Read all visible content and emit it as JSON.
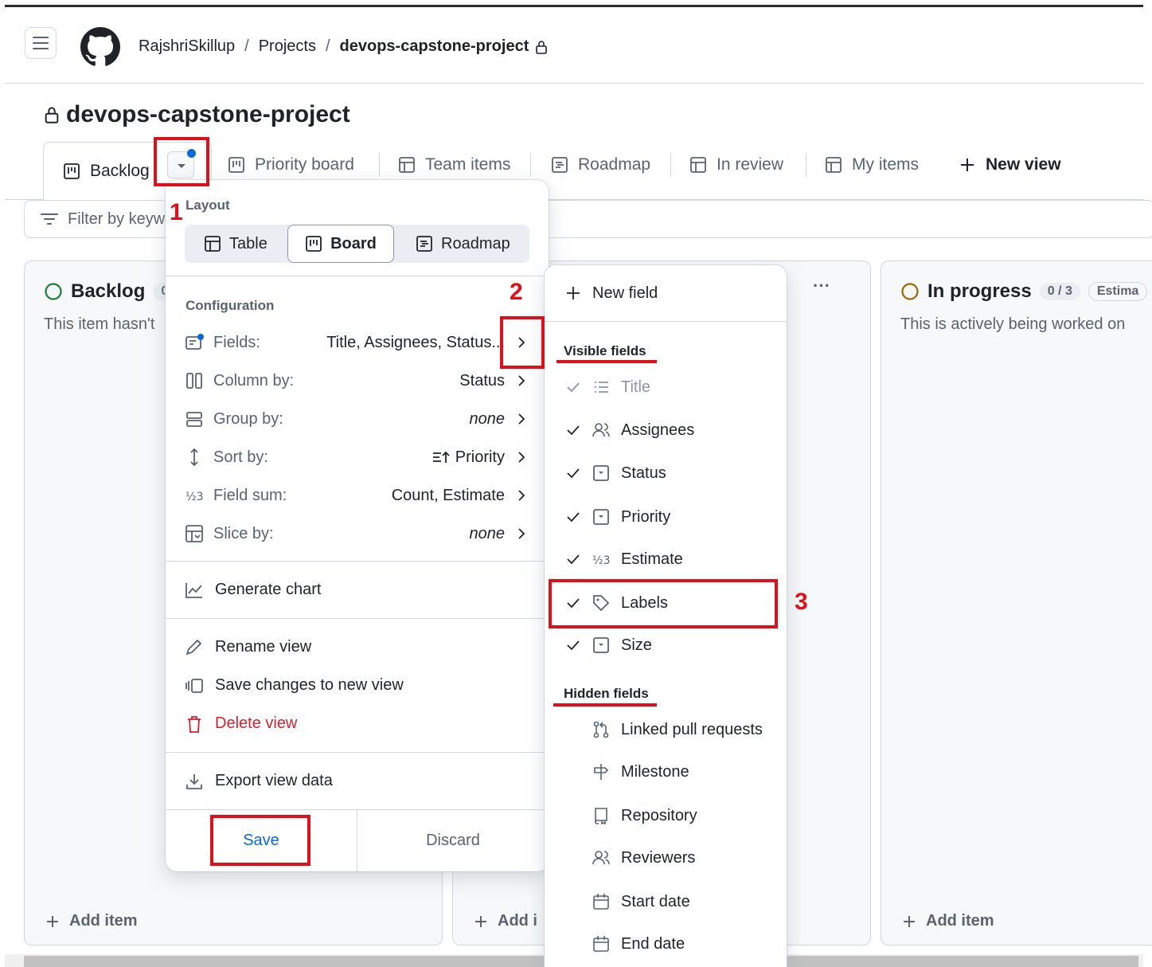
{
  "header": {
    "breadcrumb": {
      "owner": "RajshriSkillup",
      "section": "Projects",
      "project": "devops-capstone-project"
    }
  },
  "page": {
    "title": "devops-capstone-project"
  },
  "tabs": [
    {
      "label": "Backlog",
      "icon": "board-icon"
    },
    {
      "label": "Priority board",
      "icon": "board-icon"
    },
    {
      "label": "Team items",
      "icon": "table-icon"
    },
    {
      "label": "Roadmap",
      "icon": "roadmap-icon"
    },
    {
      "label": "In review",
      "icon": "table-icon"
    },
    {
      "label": "My items",
      "icon": "table-icon"
    }
  ],
  "new_view_label": "New view",
  "filter": {
    "placeholder": "Filter by keyw"
  },
  "columns": [
    {
      "title": "Backlog",
      "count": "0",
      "desc": "This item hasn't",
      "add": "Add item",
      "status_color": "#1a7f37"
    },
    {
      "title": "",
      "desc": "",
      "add": "Add i",
      "more": "···"
    },
    {
      "title": "In progress",
      "count": "0 / 3",
      "pill": "Estima",
      "desc": "This is actively being worked on",
      "add": "Add item",
      "status_color": "#9a6700"
    }
  ],
  "menu": {
    "layout_label": "Layout",
    "layouts": [
      {
        "label": "Table",
        "icon": "table-icon"
      },
      {
        "label": "Board",
        "icon": "board-icon",
        "active": true
      },
      {
        "label": "Roadmap",
        "icon": "roadmap-icon"
      }
    ],
    "config_label": "Configuration",
    "config": [
      {
        "label": "Fields:",
        "value": "Title, Assignees, Status...",
        "icon": "fields-icon"
      },
      {
        "label": "Column by:",
        "value": "Status",
        "icon": "columns-icon"
      },
      {
        "label": "Group by:",
        "value": "none",
        "icon": "rows-icon"
      },
      {
        "label": "Sort by:",
        "value": "Priority",
        "icon": "sort-icon"
      },
      {
        "label": "Field sum:",
        "value": "Count, Estimate",
        "icon": "number-icon"
      },
      {
        "label": "Slice by:",
        "value": "none",
        "icon": "slice-icon"
      }
    ],
    "generate_chart": "Generate chart",
    "rename_view": "Rename view",
    "save_new_view": "Save changes to new view",
    "delete_view": "Delete view",
    "export_view": "Export view data",
    "save": "Save",
    "discard": "Discard"
  },
  "fields_menu": {
    "new_field": "New field",
    "visible_label": "Visible fields",
    "visible": [
      "Title",
      "Assignees",
      "Status",
      "Priority",
      "Estimate",
      "Labels",
      "Size"
    ],
    "hidden_label": "Hidden fields",
    "hidden": [
      "Linked pull requests",
      "Milestone",
      "Repository",
      "Reviewers",
      "Start date",
      "End date"
    ]
  },
  "annotations": [
    "1",
    "2",
    "3"
  ],
  "colors": {
    "accent": "#0969da",
    "danger": "#cf222e",
    "annotation": "#e0101a"
  }
}
